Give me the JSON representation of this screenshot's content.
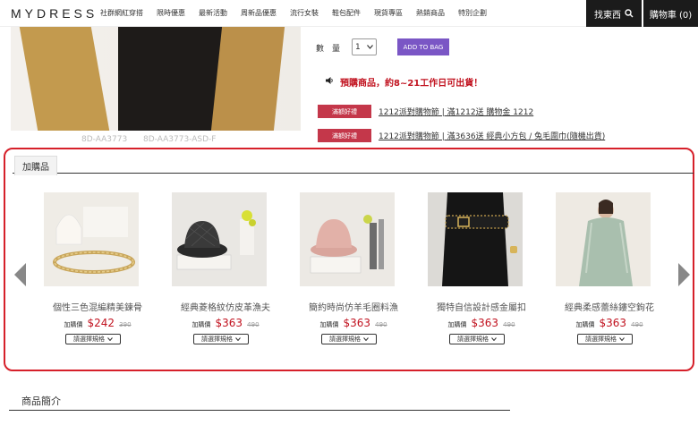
{
  "nav": {
    "logo": "MYDRESS",
    "links": [
      "社群網紅穿搭",
      "限時優惠",
      "最新活動",
      "周新品優惠",
      "流行女裝",
      "鞋包配件",
      "現貨專區",
      "熱銷商品",
      "特別企劃"
    ],
    "search_label": "找東西",
    "cart_label": "購物車 (0)"
  },
  "product": {
    "sku1": "8D-AA3773",
    "sku2": "8D-AA3773-ASD-F",
    "qty_label": "數　量",
    "qty_value": "1",
    "add_to_bag": "ADD TO BAG",
    "preorder_notice": "預購商品，約8~21工作日可出貨！",
    "promos": [
      {
        "tag": "滿額好禮",
        "text": "1212派對購物節 | 滿1212送 購物金 1212"
      },
      {
        "tag": "滿額好禮",
        "text": "1212派對購物節 | 滿3636送 經典小方包 / 兔毛圍巾(隨機出貨)"
      }
    ]
  },
  "addon": {
    "title": "加購品",
    "price_label": "加購價",
    "spec_label": "請選擇規格",
    "items": [
      {
        "name": "個性三色混編精美鍊骨",
        "price": "$242",
        "orig": "390"
      },
      {
        "name": "經典菱格紋仿皮革漁夫",
        "price": "$363",
        "orig": "490"
      },
      {
        "name": "簡約時尚仿羊毛圈料漁",
        "price": "$363",
        "orig": "490"
      },
      {
        "name": "獨特自信設計感金屬扣",
        "price": "$363",
        "orig": "490"
      },
      {
        "name": "經典柔感蕾絲鏤空鉤花",
        "price": "$363",
        "orig": "490"
      }
    ]
  },
  "description": {
    "title": "商品簡介"
  },
  "colors": {
    "accent_purple": "#7a56c5",
    "promo_red": "#c4374a",
    "price_red": "#c1121f",
    "highlight_border": "#d6202a"
  }
}
